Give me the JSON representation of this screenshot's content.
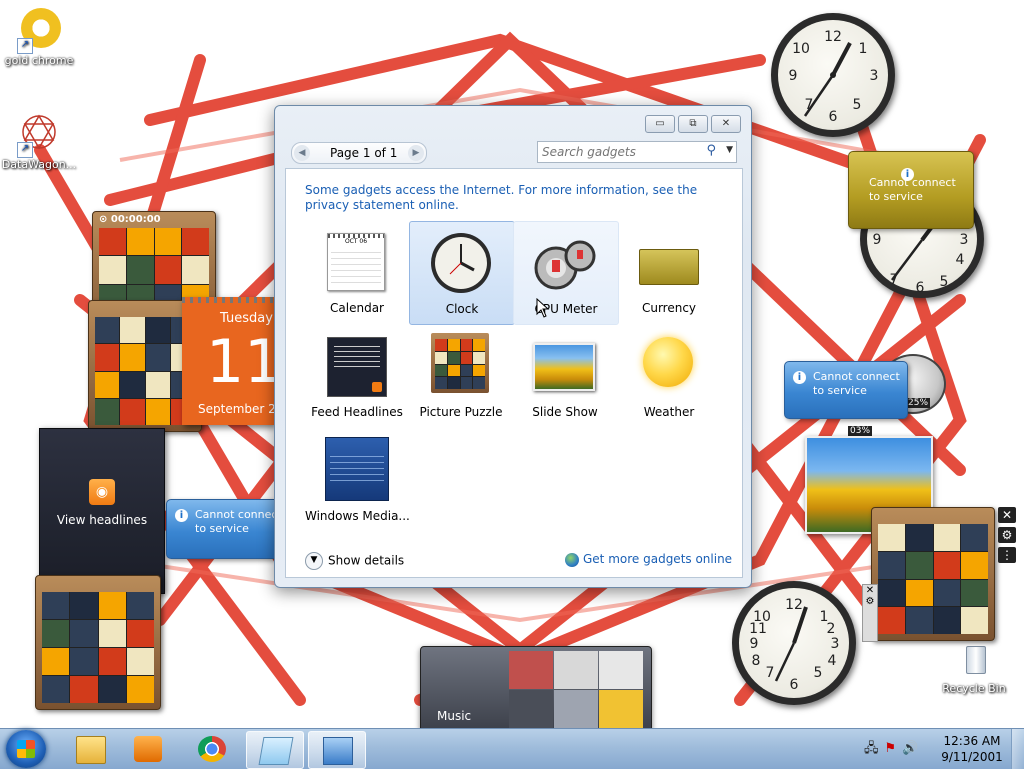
{
  "desktop": {
    "icons": [
      {
        "label": "gold chrome"
      },
      {
        "label": "DataWagon..."
      },
      {
        "label": "Recycle Bin"
      }
    ]
  },
  "gallery": {
    "pager_text": "Page 1 of 1",
    "search_placeholder": "Search gadgets",
    "info_text": "Some gadgets access the Internet.  For more information, see the privacy statement online.",
    "items": [
      {
        "label": "Calendar",
        "icon": "calendar-icon"
      },
      {
        "label": "Clock",
        "icon": "clock-icon"
      },
      {
        "label": "CPU Meter",
        "icon": "cpu-meter-icon"
      },
      {
        "label": "Currency",
        "icon": "currency-icon"
      },
      {
        "label": "Feed Headlines",
        "icon": "feed-headlines-icon"
      },
      {
        "label": "Picture Puzzle",
        "icon": "picture-puzzle-icon"
      },
      {
        "label": "Slide Show",
        "icon": "slide-show-icon"
      },
      {
        "label": "Weather",
        "icon": "weather-icon"
      },
      {
        "label": "Windows Media...",
        "icon": "windows-media-icon"
      }
    ],
    "show_details": "Show details",
    "get_more": "Get more gadgets online",
    "minimize": "▭",
    "restore": "⧉",
    "close": "✕"
  },
  "gadgets": {
    "timer": "00:00:00",
    "calendar_day": "Tuesday",
    "calendar_date": "11",
    "calendar_month": "September 2",
    "headlines_label": "View headlines",
    "cannot_connect": "Cannot connect to service",
    "cpu_pct": "25%",
    "mem_pct": "03%",
    "media_label": "Music",
    "cal_mini_month": "OCT 06"
  },
  "taskbar": {
    "time": "12:36 AM",
    "date": "9/11/2001"
  },
  "colors": {
    "accent": "#1a5fb4",
    "wallpaper_star": "#e23a2a",
    "calendar_orange": "#e8661f"
  }
}
